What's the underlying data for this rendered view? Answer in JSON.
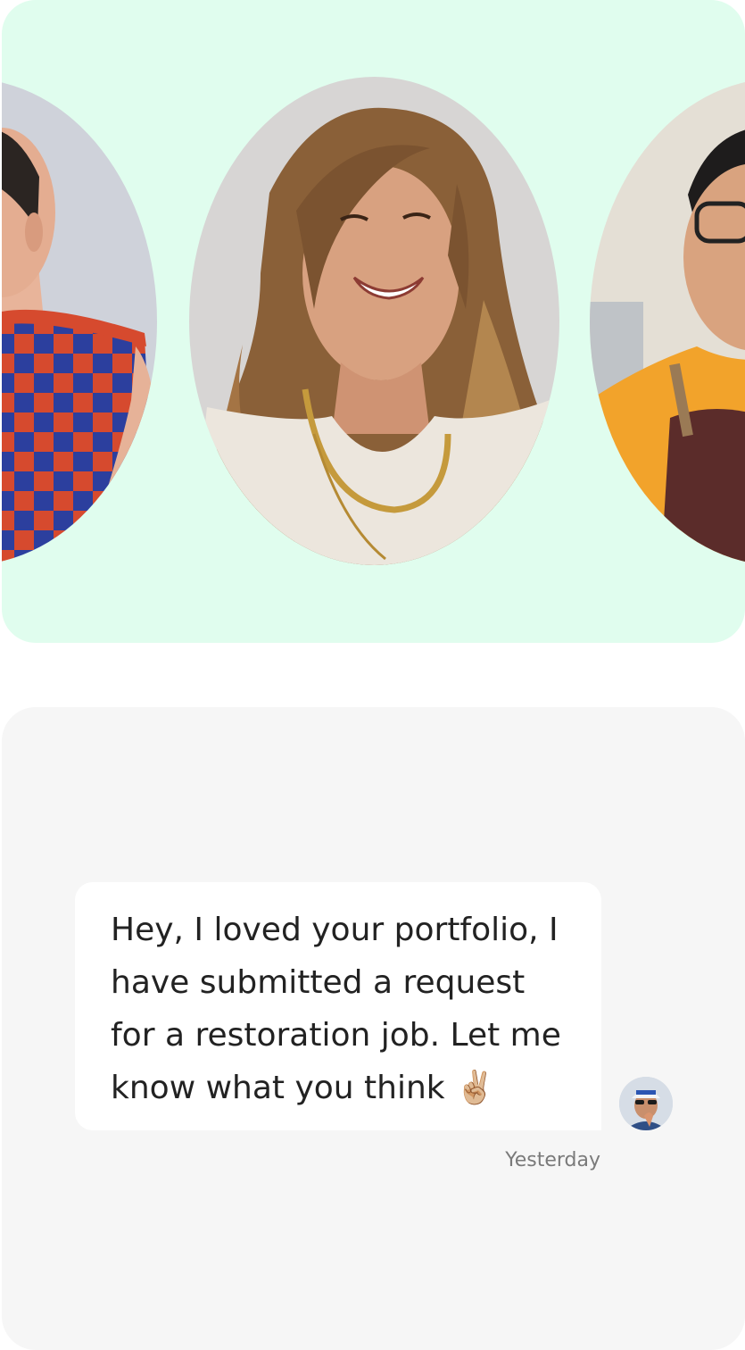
{
  "portraits": [
    {
      "name": "portrait-checkered-top"
    },
    {
      "name": "portrait-smiling-woman"
    },
    {
      "name": "portrait-man-apron"
    }
  ],
  "chat": {
    "message": "Hey, I loved your portfolio, I have submitted a request for a restoration job. Let me know what you think ✌🏼",
    "timestamp": "Yesterday"
  },
  "colors": {
    "portrait_card_bg": "#e0fdee",
    "chat_card_bg": "#f6f6f6",
    "bubble_bg": "#ffffff",
    "message_text": "#222222",
    "timestamp_text": "#7a7a7a"
  }
}
